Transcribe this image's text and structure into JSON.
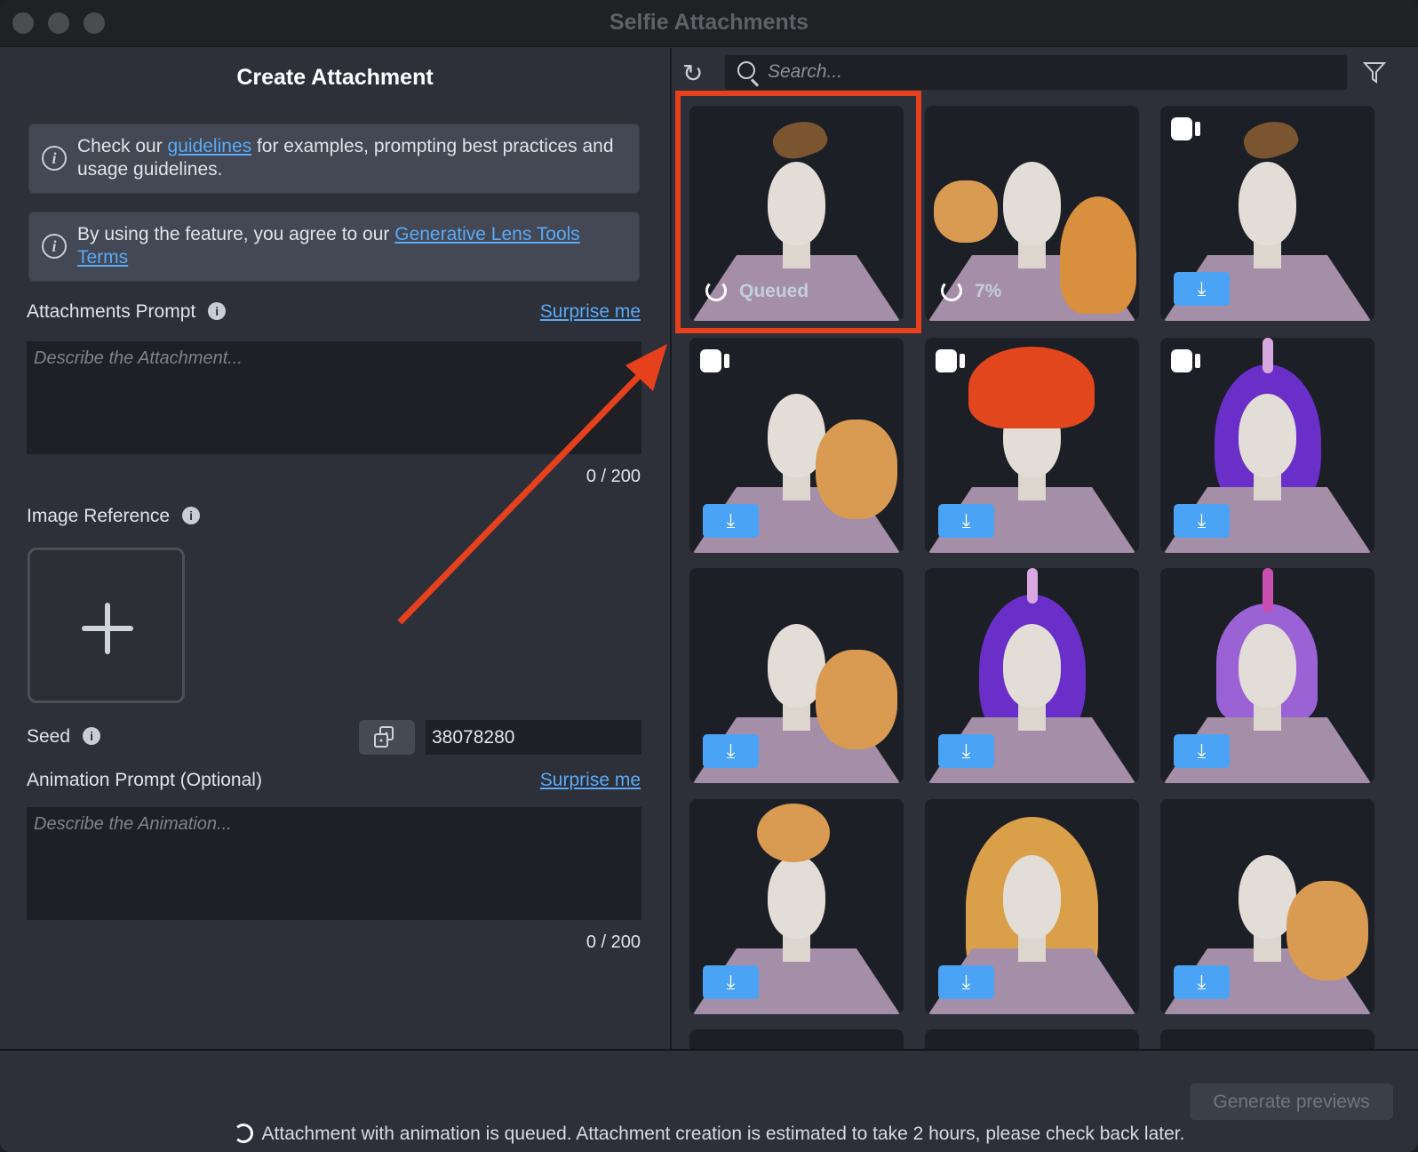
{
  "window": {
    "title": "Selfie Attachments"
  },
  "left": {
    "title": "Create Attachment",
    "info1": {
      "pre": "Check our ",
      "link": "guidelines",
      "post": " for examples, prompting best practices and usage guidelines."
    },
    "info2": {
      "pre": "By using the feature, you agree to our ",
      "link": "Generative Lens Tools Terms"
    },
    "attachments_prompt": {
      "label": "Attachments Prompt",
      "surprise": "Surprise me",
      "placeholder": "Describe the Attachment...",
      "count": "0 / 200"
    },
    "image_reference": {
      "label": "Image Reference"
    },
    "seed": {
      "label": "Seed",
      "value": "38078280"
    },
    "animation_prompt": {
      "label": "Animation Prompt (Optional)",
      "surprise": "Surprise me",
      "placeholder": "Describe the Animation...",
      "count": "0 / 200"
    }
  },
  "right": {
    "search_placeholder": "Search...",
    "items": [
      {
        "attachment": "grasshopper",
        "status": "Queued",
        "video": false
      },
      {
        "attachment": "cat on shoulders",
        "status": "7%",
        "video": false
      },
      {
        "attachment": "grasshopper",
        "video": true,
        "download": true
      },
      {
        "attachment": "cat on shoulder",
        "video": true,
        "download": true
      },
      {
        "attachment": "octopus",
        "video": true,
        "download": true
      },
      {
        "attachment": "unicorn purple wig",
        "video": true,
        "download": true
      },
      {
        "attachment": "cat on shoulder",
        "download": true
      },
      {
        "attachment": "unicorn purple wig",
        "download": true
      },
      {
        "attachment": "unicorn purple bob",
        "download": true
      },
      {
        "attachment": "cat on head",
        "download": true
      },
      {
        "attachment": "cat hat",
        "download": true
      },
      {
        "attachment": "cat on shoulder",
        "download": true
      }
    ]
  },
  "bottom": {
    "generate": "Generate previews",
    "message": "Attachment with animation is queued. Attachment creation is estimated to take 2 hours, please check back later."
  },
  "colors": {
    "accent": "#4ba3f5",
    "highlight": "#e6401d",
    "link": "#5aaaf7"
  }
}
